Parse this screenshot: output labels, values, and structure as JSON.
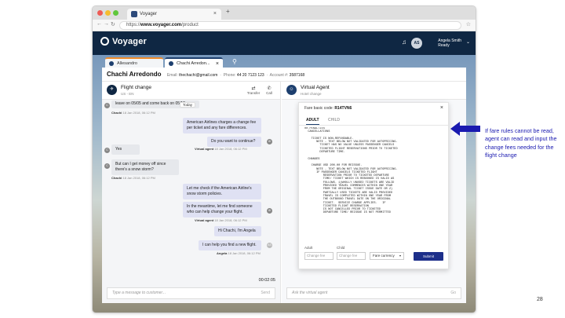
{
  "browser": {
    "tab_title": "Voyager",
    "url_prefix": "https://",
    "url_domain": "www.voyager.com",
    "url_path": "/product"
  },
  "app": {
    "logo": "Voyager",
    "user": {
      "initials": "AS",
      "name": "Angela Smith",
      "status": "Ready"
    },
    "tabs": [
      {
        "label": "Allesandro"
      },
      {
        "label": "Chachi Arredon..."
      }
    ]
  },
  "customer": {
    "name": "Chachi Arredondo",
    "email_label": "Email:",
    "email": "thechachi@gmail.com",
    "phone_label": "Phone:",
    "phone": "44 20 7123 123",
    "account_label": "Account #:",
    "account": "3587168"
  },
  "conversation": {
    "title": "Flight change",
    "subtitle": "US - EN",
    "transfer": "Transfer",
    "call": "Call",
    "today": "Today",
    "messages": [
      {
        "text": "leave on 05/05 and come back on 05/12",
        "meta_name": "Chachi",
        "meta_time": "18 Jan 2018, 06:12 PM"
      },
      {
        "text": "American Airlines charges a change fee per ticket and any fare differences."
      },
      {
        "text": "Do you want to continue?",
        "meta_name": "Virtual agent",
        "meta_time": "18 Jan 2018, 06:12 PM"
      },
      {
        "text": "Yes"
      },
      {
        "text": "But can I get money off since there's a snow storm?",
        "meta_name": "Chachi",
        "meta_time": "18 Jan 2018, 06:12 PM"
      },
      {
        "text": "Let me check if the American Airline's snow storm policies."
      },
      {
        "text": "In the meantime, let me find someone who can help change your flight.",
        "meta_name": "Virtual agent",
        "meta_time": "18 Jan 2018, 06:12 PM"
      },
      {
        "text": "Hi Chachi, I'm Angela"
      },
      {
        "text": "I can help you find a new flight.",
        "meta_name": "Angela",
        "meta_time": "18 Jan 2018, 06:12 PM"
      }
    ],
    "timer": "00:02:05",
    "composer_placeholder": "Type a message to customer...",
    "send": "Send"
  },
  "virtual_agent": {
    "title": "Virtual Agent",
    "subtitle": "Hotel change",
    "ask_placeholder": "Ask the virtual agent",
    "go": "Go"
  },
  "modal": {
    "title_prefix": "Fare basic code:",
    "code": "R14TVN6",
    "tabs": [
      "ADULT",
      "CHILD"
    ],
    "rules": "00.PENALTIES\n  CANCELLATIONS\n\n    TICKET IS NON-REFUNDABLE.\n       NOTE - TEXT BELOW NOT VALIDATED FOR AUTOPRICING.\n         TICKET HAS NO VALUE UNLESS PASSENGER CANCELS\n         TICKETED FLIGHT RESERVATIONS PRIOR TO TICKETED\n         DEPARTURE TIME.\n\n  CHANGES\n\n    CHARGE USD 200.00 FOR REISSUE.\n       NOTE - TEXT BELOW NOT VALIDATED FOR AUTOPRICING.\n       IF PASSENGER CANCELS TICKETED FLIGHT\n           RESERVATION PRIOR TO TICKETED DEPARTURE\n           TIME/ TICKET WHICH IS REBOOKED IS VALID AS\n           FOLLOWS. 1)WHOLLY UNUSED TICKETS ARE VALID\n           PROVIDED TRAVEL COMMENCES WITHIN ONE YEAR\n           FROM THE ORIGINAL TICKET ISSUE DATE OR 2)\n           PARTIALLY USED TICKETS ARE VALID PROVIDED\n           TRAVEL IS COMPLETED WITHIN ONE YEAR FROM\n           THE OUTBOUND TRAVEL DATE ON THE ORIGINAL\n           TICKET.  SERVICE CHARGE APPLIES.   IF\n           TICKETED FLIGHT RESERVATION\n           IS NOT CANCELLED PRIOR TO TICKETED\n           DEPARTURE TIME/ REISSUE IS NOT PERMITTED",
    "adult_label": "Adult",
    "child_label": "Child",
    "change_fee_placeholder": "Change fee",
    "currency": "Fare currency",
    "submit": "Submit"
  },
  "annotation": {
    "text": "If fare rules cannot be read, agent can read and input the change fees needed for the flight change",
    "color": "#1a1ab0"
  },
  "page_number": "28"
}
